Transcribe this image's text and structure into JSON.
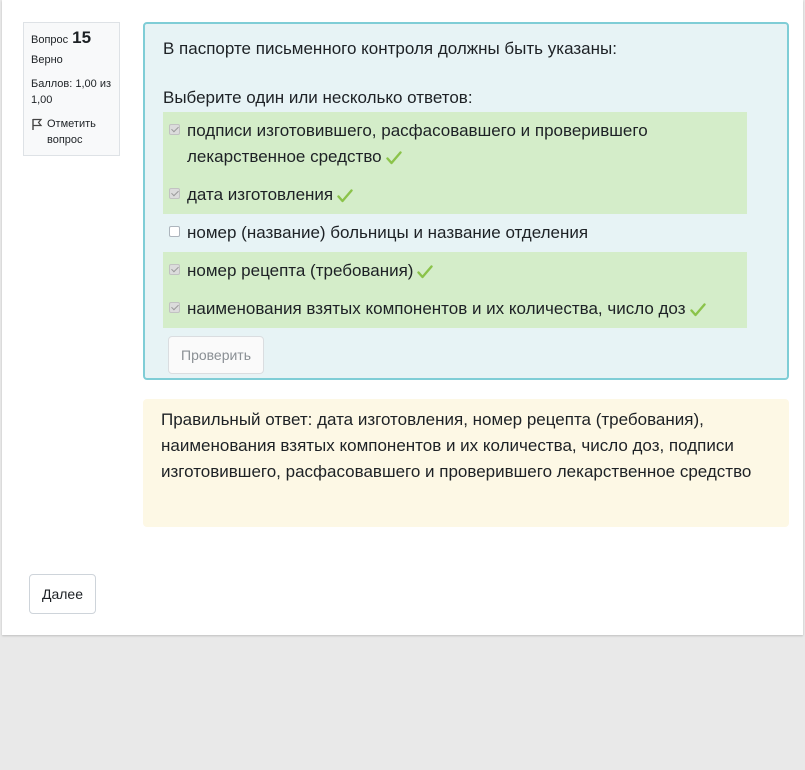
{
  "info": {
    "question_label": "Вопрос",
    "question_number": "15",
    "state": "Верно",
    "grade": "Баллов: 1,00 из 1,00",
    "flag_label": "Отметить вопрос"
  },
  "question": {
    "text": "В паспорте письменного контроля должны быть указаны:",
    "prompt": "Выберите один или несколько ответов:",
    "answers": [
      {
        "label": "подписи изготовившего, расфасовавшего и проверившего лекарственное средство",
        "checked": true,
        "correct": true
      },
      {
        "label": "дата изготовления",
        "checked": true,
        "correct": true
      },
      {
        "label": "номер (название) больницы и название отделения",
        "checked": false,
        "correct": false
      },
      {
        "label": "номер рецепта (требования)",
        "checked": true,
        "correct": true
      },
      {
        "label": "наименования взятых компонентов и их количества, число доз",
        "checked": true,
        "correct": true
      }
    ],
    "check_button": "Проверить"
  },
  "feedback": {
    "text": "Правильный ответ: дата изготовления, номер рецепта (требования), наименования взятых компонентов и их количества, число доз, подписи изготовившего, расфасовавшего и проверившего лекарственное средство"
  },
  "navigation": {
    "next_button": "Далее"
  },
  "colors": {
    "correct_bg": "#d4edc9",
    "tick": "#8bc34a",
    "formulation_bg": "#e7f3f5",
    "formulation_border": "#7fcdd6",
    "feedback_bg": "#fdf8e5"
  },
  "icons": {
    "flag": "flag-icon",
    "tick": "checkmark-icon"
  }
}
